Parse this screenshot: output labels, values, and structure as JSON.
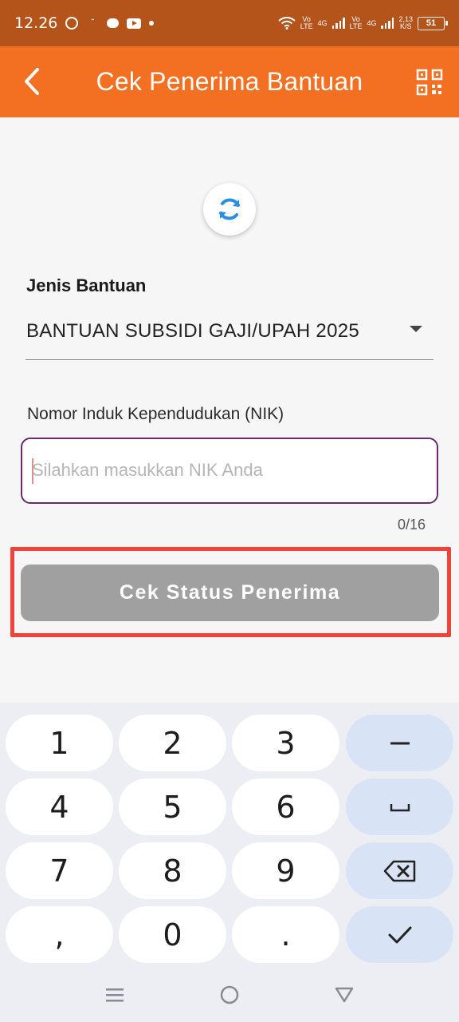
{
  "status_bar": {
    "time": "12.26",
    "wifi_lte": [
      "Vo",
      "LTE"
    ],
    "sim1": "4G",
    "wifi_lte2": [
      "Vo",
      "LTE"
    ],
    "sim2": "4G",
    "speed": [
      "2,13",
      "K/S"
    ],
    "battery": "51"
  },
  "app_bar": {
    "title": "Cek Penerima Bantuan",
    "back_icon": "chevron-left-icon",
    "qr_icon": "qr-code-icon"
  },
  "form": {
    "refresh_icon": "refresh-icon",
    "jenis_label": "Jenis Bantuan",
    "jenis_value": "BANTUAN SUBSIDI GAJI/UPAH 2025",
    "nik_label": "Nomor Induk Kependudukan (NIK)",
    "nik_placeholder": "Silahkan masukkan NIK Anda",
    "nik_value": "",
    "counter": "0/16",
    "submit_label": "Cek Status Penerima"
  },
  "colors": {
    "app_bar": "#f36f21",
    "status_bar": "#b4541b",
    "input_border": "#6a2a6e",
    "highlight": "#f14339",
    "button_disabled": "#a0a0a0"
  },
  "keyboard": {
    "keys": [
      {
        "label": "1"
      },
      {
        "label": "2"
      },
      {
        "label": "3"
      },
      {
        "label": "–",
        "icon": "minus-icon"
      },
      {
        "label": "4"
      },
      {
        "label": "5"
      },
      {
        "label": "6"
      },
      {
        "label": "␣",
        "icon": "space-icon"
      },
      {
        "label": "7"
      },
      {
        "label": "8"
      },
      {
        "label": "9"
      },
      {
        "label": "",
        "icon": "backspace-icon"
      },
      {
        "label": ","
      },
      {
        "label": "0"
      },
      {
        "label": "."
      },
      {
        "label": "",
        "icon": "checkmark-icon"
      }
    ]
  },
  "nav_bar": {
    "icons": [
      "menu-icon",
      "home-icon",
      "back-triangle-icon"
    ]
  }
}
